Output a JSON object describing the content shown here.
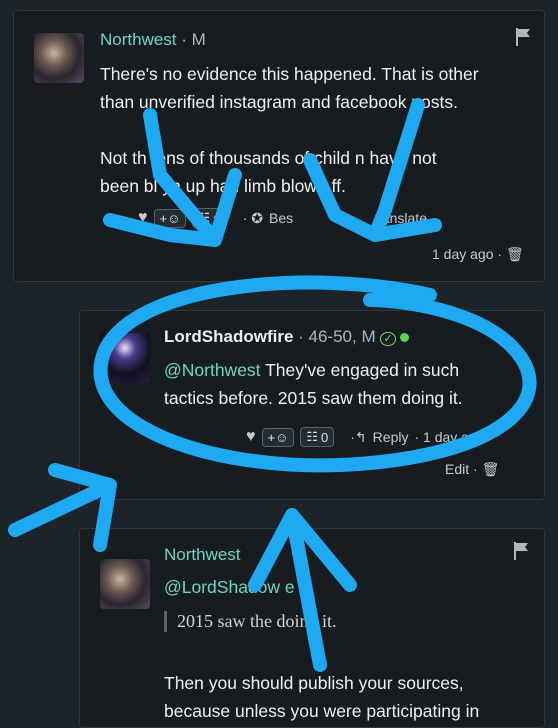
{
  "comments": [
    {
      "author": "Northwest",
      "meta": " · M",
      "lines": [
        "There's no evidence this happened. That is other",
        "than unverified instagram and facebook posts.",
        "",
        "Not th  tens of thousands of child  n have not",
        "been bl   yn up    had limb  blown  ff."
      ],
      "actions": {
        "best": "Bes",
        "translate": "ranslate ·"
      },
      "time": "1 day ago ·"
    },
    {
      "author": "LordShadowfire",
      "meta": " · 46-50, M",
      "mention": "@Northwest",
      "line1_rest": " They've engaged in such",
      "line2": "tactics before. 2015 saw them doing it.",
      "reaction_count": "0",
      "reply": "Reply",
      "time": "· 1 day a",
      "edit": "Edit ·"
    },
    {
      "author": "Northwest",
      "mention": "@LordShadow e",
      "quote": "2015 saw the   doing it.",
      "lines": [
        "Then you should publish your sources,",
        "because unless you were participating in"
      ]
    }
  ],
  "colors": {
    "accent": "#6fd6c2",
    "annotation": "#1fa9f2",
    "background": "#1c2329"
  },
  "icons": [
    "flag-icon",
    "heart-icon",
    "add-emoji-icon",
    "list-icon",
    "badge-icon",
    "reply-icon",
    "trash-icon",
    "verified-icon",
    "online-dot-icon"
  ]
}
